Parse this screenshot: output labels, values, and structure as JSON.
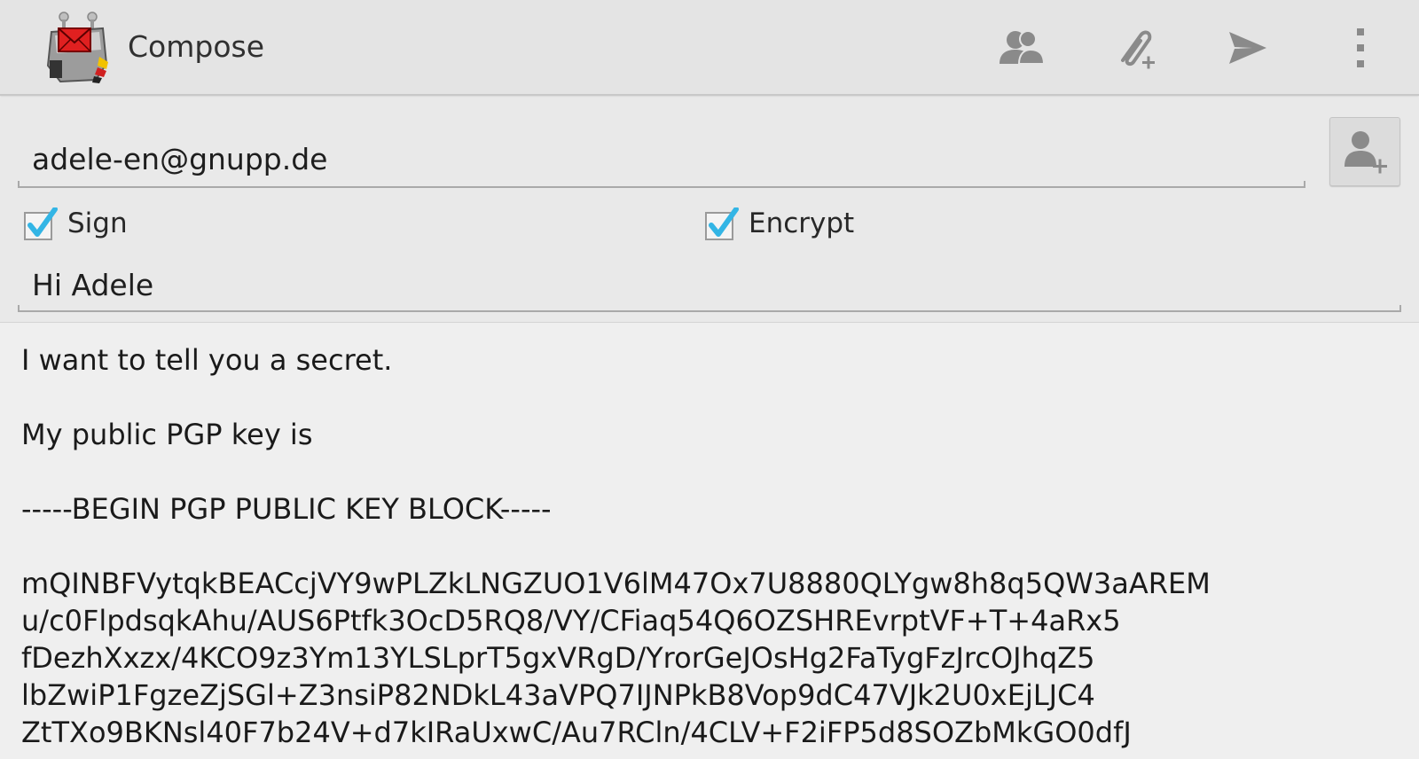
{
  "action_bar": {
    "title": "Compose",
    "icons": [
      "app-mail-robot-icon",
      "contacts-icon",
      "attach-icon",
      "send-icon",
      "overflow-menu-icon"
    ]
  },
  "to_field": {
    "value": "adele-en@gnupp.de"
  },
  "options": {
    "sign_label": "Sign",
    "sign_checked": true,
    "encrypt_label": "Encrypt",
    "encrypt_checked": true
  },
  "subject_field": {
    "value": "Hi Adele"
  },
  "message": {
    "line1": "I want to tell you a secret.",
    "line2": "My public PGP key is",
    "line3": "-----BEGIN PGP PUBLIC KEY BLOCK-----",
    "key_lines": [
      "mQINBFVytqkBEACcjVY9wPLZkLNGZUO1V6lM47Ox7U8880QLYgw8h8q5QW3aAREM",
      "u/c0FlpdsqkAhu/AUS6Ptfk3OcD5RQ8/VY/CFiaq54Q6OZSHREvrptVF+T+4aRx5",
      "fDezhXxzx/4KCO9z3Ym13YLSLprT5gxVRgD/YrorGeJOsHg2FaTygFzJrcOJhqZ5",
      "lbZwiP1FgzeZjSGl+Z3nsiP82NDkL43aVPQ7IJNPkB8Vop9dC47VJk2U0xEjLJC4",
      "ZtTXo9BKNsl40F7b24V+d7kIRaUxwC/Au7RCln/4CLV+F2iFP5d8SOZbMkGO0dfJ"
    ]
  },
  "colors": {
    "action_bar_bg": "#e4e4e4",
    "checkbox_accent": "#33b5e5",
    "icon_gray": "#8a8a8a"
  }
}
